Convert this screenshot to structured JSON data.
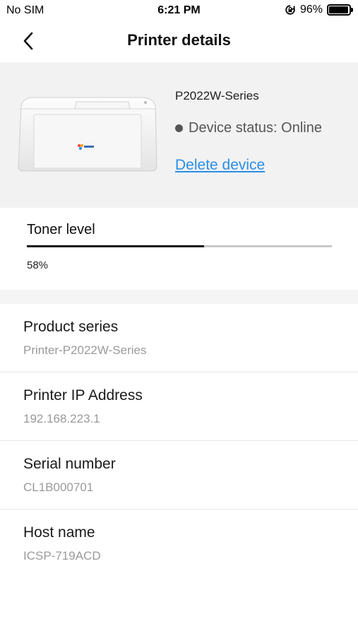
{
  "status_bar": {
    "carrier": "No SIM",
    "time": "6:21 PM",
    "battery_percent": "96%",
    "battery_level": 0.96,
    "icons": [
      "orientation-lock-icon",
      "battery-icon"
    ]
  },
  "nav": {
    "back_icon": "chevron-left-icon",
    "title": "Printer details"
  },
  "device": {
    "name": "P2022W-Series",
    "status": "Device status: Online",
    "delete_label": "Delete device"
  },
  "toner": {
    "label": "Toner level",
    "percent_text": "58%",
    "level": 0.58
  },
  "info": [
    {
      "title": "Product series",
      "value": "Printer-P2022W-Series"
    },
    {
      "title": "Printer IP Address",
      "value": "192.168.223.1"
    },
    {
      "title": "Serial number",
      "value": "CL1B000701"
    },
    {
      "title": "Host name",
      "value": "ICSP-719ACD"
    }
  ],
  "colors": {
    "link": "#2a8ee6",
    "card_background": "#f2f2f2",
    "muted_text": "#9a9a9a"
  }
}
